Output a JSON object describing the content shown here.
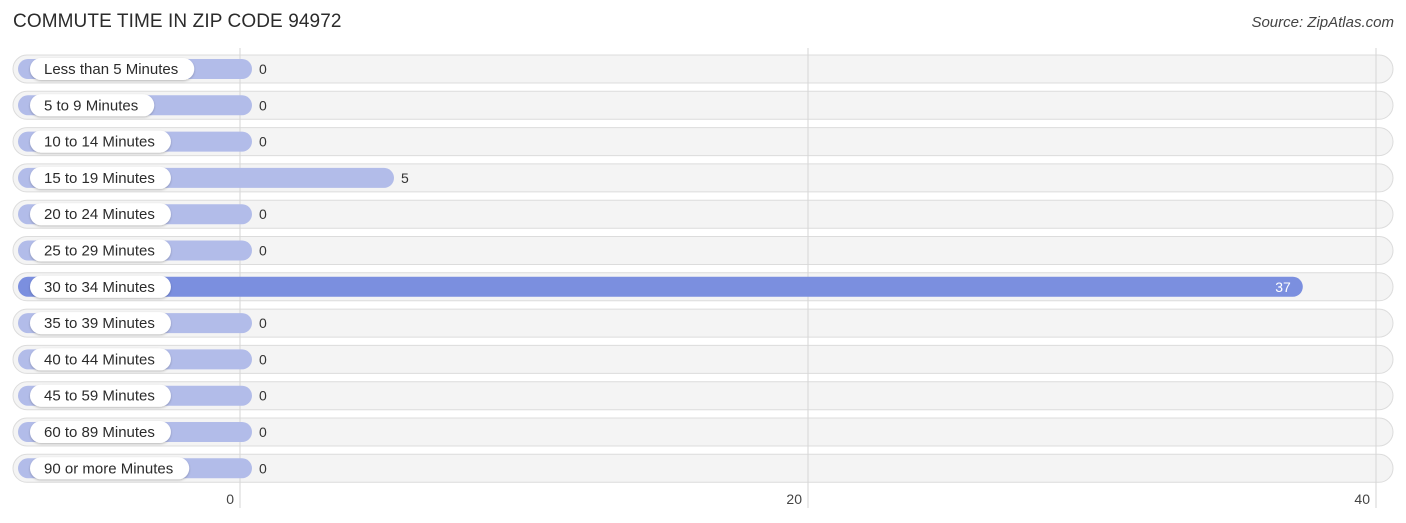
{
  "header": {
    "title": "COMMUTE TIME IN ZIP CODE 94972",
    "source": "Source: ZipAtlas.com"
  },
  "colors": {
    "bar_normal": "#b2bce9",
    "bar_highlight": "#7b8fdf",
    "track": "#f4f4f4",
    "track_border": "#dcdcdc",
    "grid": "#d6d6d6"
  },
  "chart_data": {
    "type": "bar",
    "orientation": "horizontal",
    "title": "COMMUTE TIME IN ZIP CODE 94972",
    "xlabel": "",
    "ylabel": "",
    "categories": [
      "Less than 5 Minutes",
      "5 to 9 Minutes",
      "10 to 14 Minutes",
      "15 to 19 Minutes",
      "20 to 24 Minutes",
      "25 to 29 Minutes",
      "30 to 34 Minutes",
      "35 to 39 Minutes",
      "40 to 44 Minutes",
      "45 to 59 Minutes",
      "60 to 89 Minutes",
      "90 or more Minutes"
    ],
    "values": [
      0,
      0,
      0,
      5,
      0,
      0,
      37,
      0,
      0,
      0,
      0,
      0
    ],
    "xlim": [
      0,
      40
    ],
    "xticks": [
      0,
      20,
      40
    ],
    "xtick_labels": [
      "0",
      "20",
      "40"
    ],
    "grid": true,
    "highlight_index": 6
  }
}
